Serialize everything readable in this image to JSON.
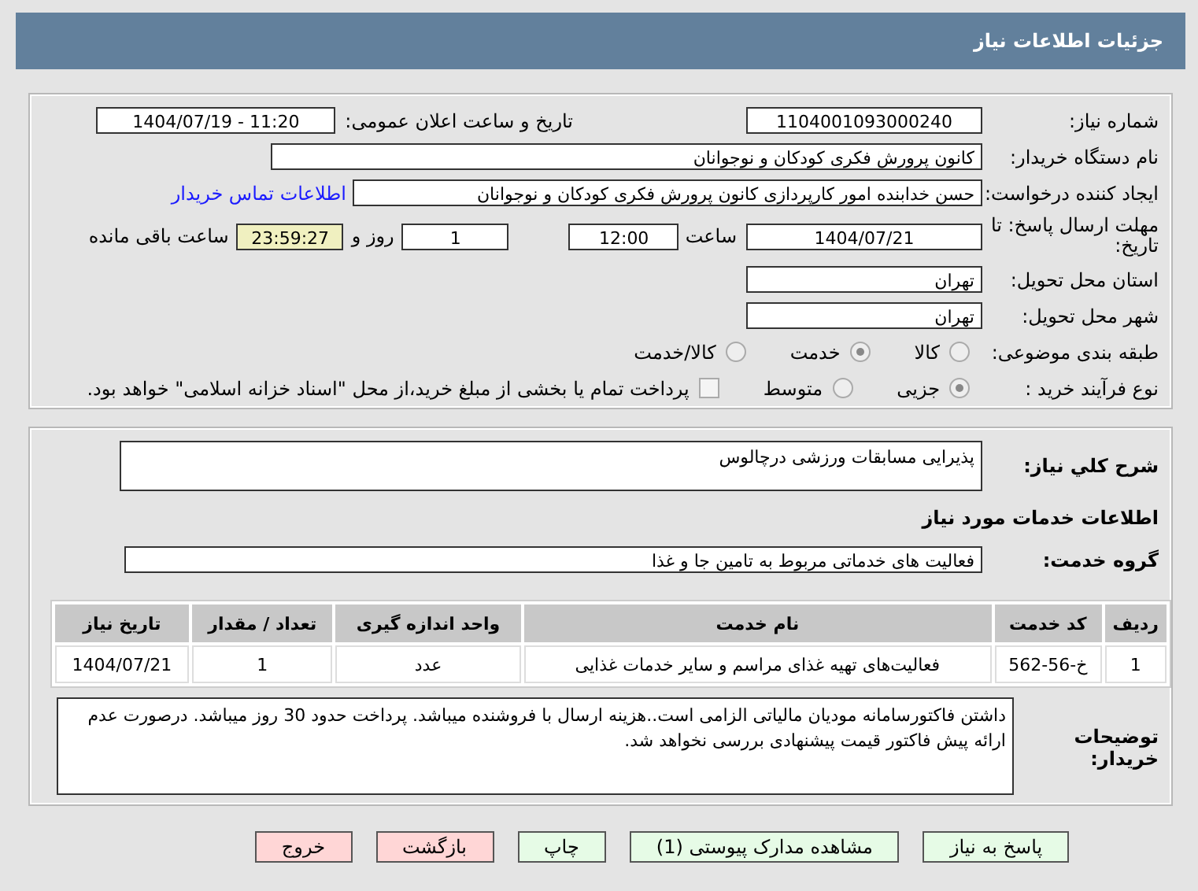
{
  "header": {
    "title": "جزئیات اطلاعات نیاز"
  },
  "details": {
    "need_number": {
      "label": "شماره نیاز:",
      "value": "1104001093000240"
    },
    "announce": {
      "label": "تاریخ و ساعت اعلان عمومی:",
      "value": "1404/07/19 - 11:20"
    },
    "buyer_org": {
      "label": "نام دستگاه خریدار:",
      "value": "کانون پرورش فکری کودکان و نوجوانان"
    },
    "creator": {
      "label": "ایجاد کننده درخواست:",
      "value": "حسن خدابنده امور کارپردازی  کانون پرورش فکری کودکان و نوجوانان",
      "link": "اطلاعات تماس خریدار"
    },
    "deadline": {
      "label": "مهلت ارسال پاسخ: تا تاریخ:",
      "date": "1404/07/21",
      "time_label": "ساعت",
      "time": "12:00",
      "days": "1",
      "days_label": "روز و",
      "remaining": "23:59:27",
      "remaining_label": "ساعت باقی مانده"
    },
    "province": {
      "label": "استان محل تحویل:",
      "value": "تهران"
    },
    "city": {
      "label": "شهر محل تحویل:",
      "value": "تهران"
    },
    "category": {
      "label": "طبقه بندی موضوعی:",
      "options": [
        {
          "label": "کالا",
          "selected": false
        },
        {
          "label": "خدمت",
          "selected": true
        },
        {
          "label": "کالا/خدمت",
          "selected": false
        }
      ]
    },
    "process": {
      "label": "نوع فرآیند خرید :",
      "options": [
        {
          "label": "جزیی",
          "selected": true
        },
        {
          "label": "متوسط",
          "selected": false
        }
      ],
      "treasury": {
        "label": "پرداخت تمام یا بخشی از مبلغ خرید،از محل \"اسناد خزانه اسلامی\" خواهد بود.",
        "checked": false
      }
    }
  },
  "need": {
    "label": "شرح کلي نیاز:",
    "value": "پذیرایی مسابقات ورزشی درچالوس"
  },
  "services_title": "اطلاعات خدمات مورد نیاز",
  "group": {
    "label": "گروه خدمت:",
    "value": "فعالیت های خدماتی مربوط به تامین جا و غذا"
  },
  "table": {
    "columns": [
      "ردیف",
      "کد خدمت",
      "نام خدمت",
      "واحد اندازه گیری",
      "تعداد / مقدار",
      "تاریخ نیاز"
    ],
    "rows": [
      [
        "1",
        "خ-56-562",
        "فعالیت‌های تهیه غذای مراسم و سایر خدمات غذایی",
        "عدد",
        "1",
        "1404/07/21"
      ]
    ]
  },
  "notes": {
    "label": "توضیحات خریدار:",
    "value": "داشتن فاکتورسامانه مودیان مالیاتی الزامی است..هزینه ارسال با فروشنده میباشد. پرداخت حدود 30 روز میباشد. درصورت عدم ارائه پیش فاکتور قیمت پیشنهادی بررسی نخواهد شد."
  },
  "buttons": [
    {
      "label": "پاسخ به نیاز",
      "kind": "action"
    },
    {
      "label": "مشاهده مدارک پیوستی (1)",
      "kind": "action"
    },
    {
      "label": "چاپ",
      "kind": "action"
    },
    {
      "label": "بازگشت",
      "kind": "exit"
    },
    {
      "label": "خروج",
      "kind": "exit"
    }
  ]
}
